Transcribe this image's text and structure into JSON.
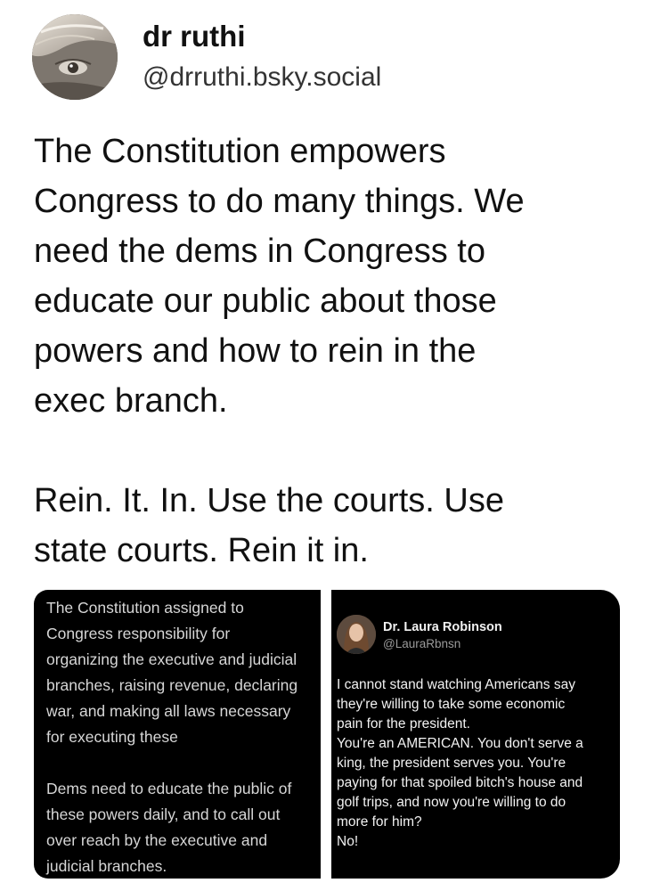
{
  "post": {
    "author": {
      "display_name": "dr ruthi",
      "handle": "@drruthi.bsky.social",
      "avatar_icon": "profile-photo"
    },
    "text": "The Constitution empowers\nCongress to do many things. We\nneed the dems in Congress to\neducate our public about those\npowers and how to rein in the\nexec branch.\n\nRein. It. In. Use the courts. Use\nstate courts. Rein it in.",
    "images": [
      {
        "text": "The Constitution assigned to\nCongress responsibility for\norganizing the executive and judicial\nbranches, raising revenue, declaring\nwar, and making all laws necessary\nfor executing these\n\nDems need to educate the public of\nthese powers daily, and to call out\nover reach by the executive and\njudicial branches."
      },
      {
        "quoted_author": {
          "name": "Dr. Laura Robinson",
          "handle": "@LauraRbnsn"
        },
        "text": "I cannot stand watching Americans say\nthey're willing to take some economic\npain for the president.\nYou're an AMERICAN. You don't serve a\nking, the president serves you. You're\npaying for that spoiled bitch's house and\ngolf trips, and now you're willing to do\nmore for him?\nNo!"
      }
    ]
  },
  "colors": {
    "background": "#ffffff",
    "text": "#111111",
    "image_background": "#000000"
  }
}
